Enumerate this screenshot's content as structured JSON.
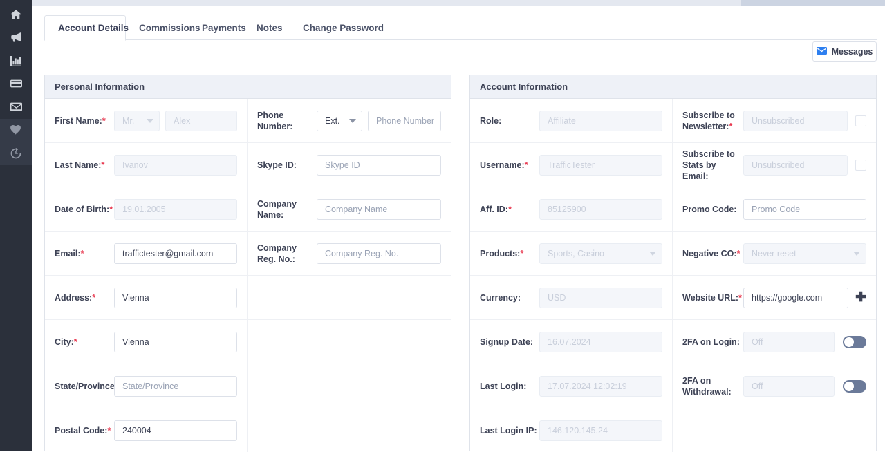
{
  "sidebar": {
    "items": [
      {
        "icon": "home-icon",
        "name": "sidebar-item-home"
      },
      {
        "icon": "megaphone-icon",
        "name": "sidebar-item-campaigns"
      },
      {
        "icon": "bar-chart-icon",
        "name": "sidebar-item-reports"
      },
      {
        "icon": "credit-card-icon",
        "name": "sidebar-item-payments"
      },
      {
        "icon": "envelope-icon",
        "name": "sidebar-item-messages"
      },
      {
        "icon": "heart-icon",
        "name": "sidebar-item-favorites"
      },
      {
        "icon": "history-icon",
        "name": "sidebar-item-history"
      }
    ]
  },
  "tabs": [
    {
      "label": "Account Details",
      "active": true
    },
    {
      "label": "Commissions",
      "active": false
    },
    {
      "label": "Payments",
      "active": false
    },
    {
      "label": "Notes",
      "active": false
    },
    {
      "label": "Change Password",
      "active": false
    }
  ],
  "toolbar": {
    "messages_label": "Messages",
    "messages_icon": "envelope-icon"
  },
  "personal": {
    "title": "Personal Information",
    "rows": [
      {
        "left": {
          "label": "First Name:",
          "required": true,
          "select_value": "Mr.",
          "select_disabled": true,
          "value": "Alex",
          "disabled": true
        },
        "right": {
          "label": "Phone Number:",
          "required": false,
          "select_value": "Ext.",
          "select_disabled": false,
          "placeholder": "Phone Number",
          "disabled": false
        }
      },
      {
        "left": {
          "label": "Last Name:",
          "required": true,
          "value": "Ivanov",
          "disabled": true
        },
        "right": {
          "label": "Skype ID:",
          "required": false,
          "placeholder": "Skype ID",
          "disabled": false
        }
      },
      {
        "left": {
          "label": "Date of Birth:",
          "required": true,
          "value": "19.01.2005",
          "disabled": true
        },
        "right": {
          "label": "Company Name:",
          "required": false,
          "placeholder": "Company Name",
          "disabled": false
        }
      },
      {
        "left": {
          "label": "Email:",
          "required": true,
          "value": "traffictester@gmail.com",
          "disabled": false
        },
        "right": {
          "label": "Company Reg. No.:",
          "required": false,
          "placeholder": "Company Reg. No.",
          "disabled": false
        }
      },
      {
        "left": {
          "label": "Address:",
          "required": true,
          "value": "Vienna",
          "disabled": false
        },
        "right": {
          "label": "",
          "empty": true
        }
      },
      {
        "left": {
          "label": "City:",
          "required": true,
          "value": "Vienna",
          "disabled": false
        },
        "right": {
          "label": "",
          "empty": true
        }
      },
      {
        "left": {
          "label": "State/Province:",
          "required": false,
          "placeholder": "State/Province",
          "disabled": false
        },
        "right": {
          "label": "",
          "empty": true
        }
      },
      {
        "left": {
          "label": "Postal Code:",
          "required": true,
          "value": "240004",
          "disabled": false
        },
        "right": {
          "label": "",
          "empty": true
        }
      }
    ]
  },
  "account": {
    "title": "Account Information",
    "rows": [
      {
        "left": {
          "label": "Role:",
          "required": false,
          "value": "Affiliate",
          "disabled": true
        },
        "right": {
          "label": "Subscribe to Newsletter:",
          "required": true,
          "value": "Unsubscribed",
          "disabled": true,
          "control": "checkbox"
        }
      },
      {
        "left": {
          "label": "Username:",
          "required": true,
          "value": "TrafficTester",
          "disabled": true
        },
        "right": {
          "label": "Subscribe to Stats by Email:",
          "required": false,
          "value": "Unsubscribed",
          "disabled": true,
          "control": "checkbox"
        }
      },
      {
        "left": {
          "label": "Aff. ID:",
          "required": true,
          "value": "85125900",
          "disabled": true
        },
        "right": {
          "label": "Promo Code:",
          "required": false,
          "placeholder": "Promo Code",
          "disabled": false
        }
      },
      {
        "left": {
          "label": "Products:",
          "required": true,
          "value": "Sports, Casino",
          "disabled": true,
          "control": "select"
        },
        "right": {
          "label": "Negative CO:",
          "required": true,
          "value": "Never reset",
          "disabled": true,
          "control": "select"
        }
      },
      {
        "left": {
          "label": "Currency:",
          "required": false,
          "value": "USD",
          "disabled": true
        },
        "right": {
          "label": "Website URL:",
          "required": true,
          "value": "https://google.com",
          "disabled": false,
          "control": "plus"
        }
      },
      {
        "left": {
          "label": "Signup Date:",
          "required": false,
          "value": "16.07.2024",
          "disabled": true
        },
        "right": {
          "label": "2FA on Login:",
          "required": false,
          "value": "Off",
          "disabled": true,
          "control": "toggle",
          "toggle_on": false
        }
      },
      {
        "left": {
          "label": "Last Login:",
          "required": false,
          "value": "17.07.2024 12:02:19",
          "disabled": true
        },
        "right": {
          "label": "2FA on Withdrawal:",
          "required": false,
          "value": "Off",
          "disabled": true,
          "control": "toggle",
          "toggle_on": false
        }
      },
      {
        "left": {
          "label": "Last Login IP:",
          "required": false,
          "value": "146.120.145.24",
          "disabled": true
        },
        "right": {
          "label": "",
          "empty": true
        }
      }
    ]
  },
  "colors": {
    "sidebar_bg": "#2b303b",
    "sidebar_lower_bg": "#353b48",
    "panel_head_bg": "#eef1f7",
    "required_red": "#e8384f",
    "accent_blue": "#2d7ff0",
    "toggle_off": "#6b7a99"
  }
}
